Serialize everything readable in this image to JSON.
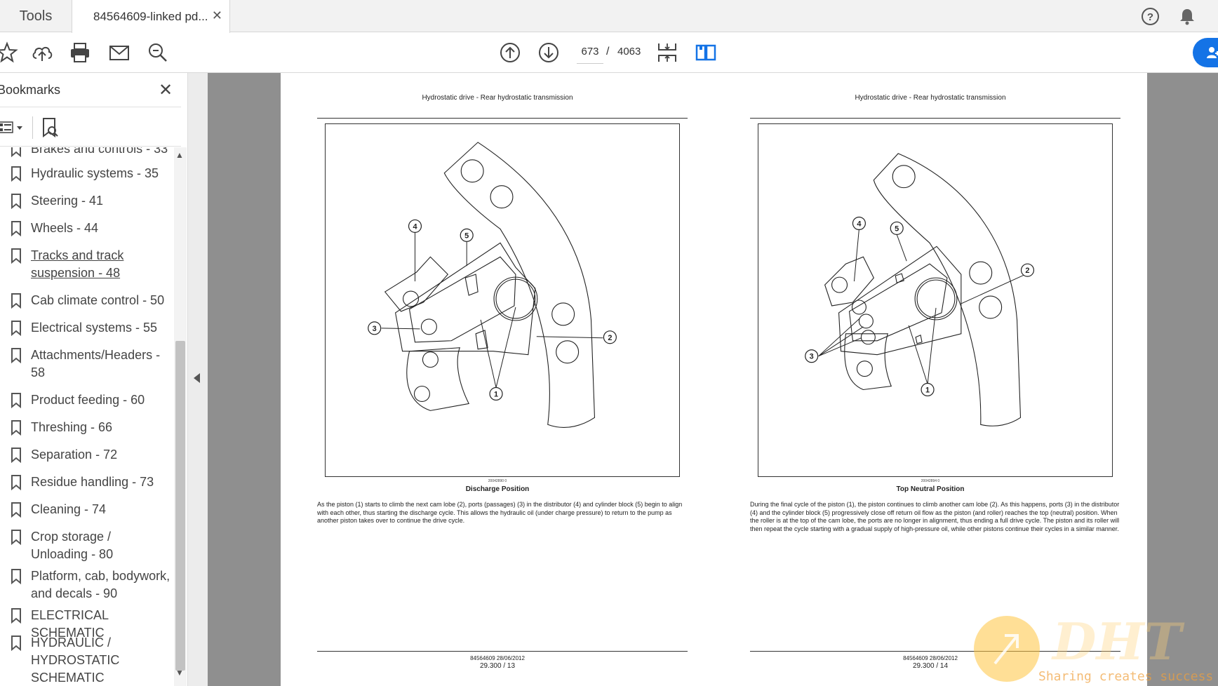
{
  "tabs": {
    "tools": "Tools",
    "document": "84564609-linked pd..."
  },
  "toolbar": {
    "current_page": "673",
    "page_sep": "/",
    "total_pages": "4063"
  },
  "panel": {
    "title": "Bookmarks",
    "items": [
      {
        "label": "Brakes and controls - 33"
      },
      {
        "label": "Hydraulic systems - 35"
      },
      {
        "label": "Steering - 41"
      },
      {
        "label": "Wheels - 44"
      },
      {
        "label": "Tracks and track suspension - 48"
      },
      {
        "label": "Cab climate control - 50"
      },
      {
        "label": "Electrical systems - 55"
      },
      {
        "label": "Attachments/Headers - 58"
      },
      {
        "label": "Product feeding - 60"
      },
      {
        "label": "Threshing - 66"
      },
      {
        "label": "Separation - 72"
      },
      {
        "label": "Residue handling - 73"
      },
      {
        "label": "Cleaning - 74"
      },
      {
        "label": "Crop storage / Unloading - 80"
      },
      {
        "label": "Platform, cab, bodywork, and decals - 90"
      },
      {
        "label": "ELECTRICAL SCHEMATIC"
      },
      {
        "label": "HYDRAULIC / HYDROSTATIC SCHEMATIC"
      }
    ]
  },
  "pages": {
    "left": {
      "header": "Hydrostatic drive - Rear hydrostatic transmission",
      "fig_id": "20042890    0",
      "caption": "Discharge Position",
      "callouts": [
        "1",
        "2",
        "3",
        "4",
        "5"
      ],
      "text": "As the piston (1) starts to climb the next cam lobe (2), ports (passages) (3) in the distributor (4) and cylinder block (5) begin to align with each other, thus starting the discharge cycle. This allows the hydraulic oil (under charge pressure) to return to the pump as another piston takes over to continue the drive cycle.",
      "footer_id": "84564609 28/06/2012",
      "footer_page": "29.300 / 13"
    },
    "right": {
      "header": "Hydrostatic drive - Rear hydrostatic transmission",
      "fig_id": "20042894    0",
      "caption": "Top Neutral Position",
      "callouts": [
        "1",
        "2",
        "3",
        "4",
        "5"
      ],
      "text": "During the final cycle of the piston (1), the piston continues to climb another cam lobe (2). As this happens, ports (3) in the distributor (4) and the cylinder block (5) progressively close off return oil flow as the piston (and roller) reaches the top (neutral) position. When the roller is at the top of the cam lobe, the ports are no longer in alignment, thus ending a full drive cycle. The piston and its roller will then repeat the cycle starting with a gradual supply of high-pressure oil, while other pistons continue their cycles in a similar manner.",
      "footer_id": "84564609 28/06/2012",
      "footer_page": "29.300 / 14"
    }
  },
  "watermark": {
    "logo": "DHT",
    "tagline": "Sharing creates success"
  }
}
